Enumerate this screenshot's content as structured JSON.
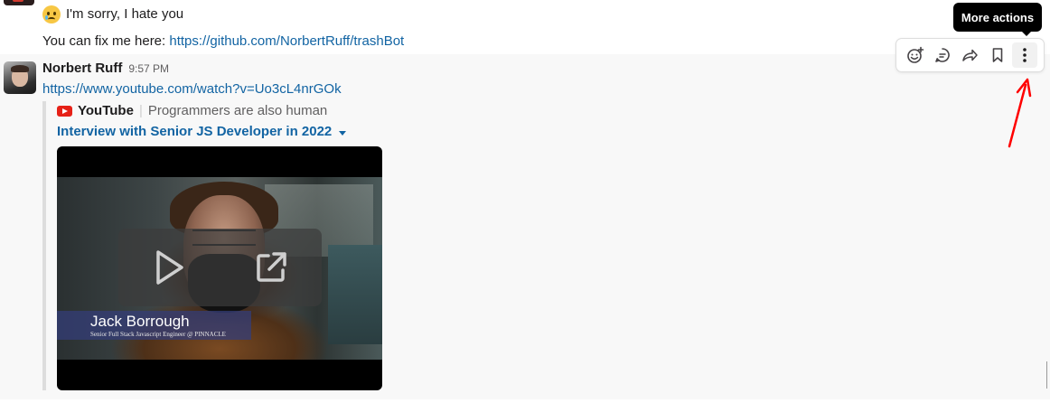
{
  "messages": [
    {
      "line1_text": "I'm sorry, I hate you",
      "emoji": "sad-tear-emoji",
      "line2_prefix": "You can fix me here: ",
      "line2_link": "https://github.com/NorbertRuff/trashBot"
    },
    {
      "sender": "Norbert Ruff",
      "time": "9:57 PM",
      "link": "https://www.youtube.com/watch?v=Uo3cL4nrGOk",
      "attachment": {
        "service": "YouTube",
        "separator": "|",
        "channel": "Programmers are also human",
        "title": "Interview with Senior JS Developer in 2022",
        "video": {
          "overlay_name": "Jack Borrough",
          "overlay_role": "Senior Full Stack Javascript Engineer @ PINNACLE",
          "controls": [
            "play-icon",
            "open-external-icon"
          ]
        }
      }
    }
  ],
  "actions_toolbar": {
    "icons": [
      "add-reaction-icon",
      "reply-in-thread-icon",
      "share-icon",
      "save-bookmark-icon",
      "more-actions-icon"
    ],
    "tooltip": "More actions"
  },
  "colors": {
    "link": "#1264a3",
    "youtube_red": "#e62117",
    "annotation": "#ff0000"
  }
}
